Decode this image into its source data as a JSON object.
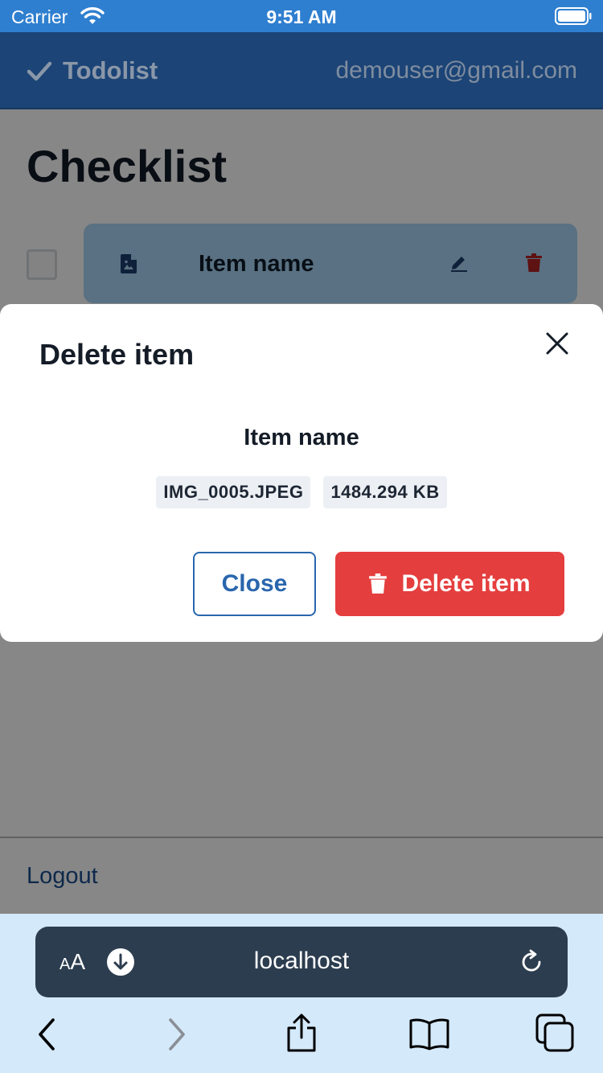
{
  "status_bar": {
    "carrier": "Carrier",
    "time": "9:51 AM"
  },
  "header": {
    "brand": "Todolist",
    "user_email": "demouser@gmail.com"
  },
  "page": {
    "title": "Checklist",
    "item_name": "Item name",
    "logout": "Logout"
  },
  "modal": {
    "title": "Delete item",
    "item_name": "Item name",
    "file_name": "IMG_0005.JPEG",
    "file_size": "1484.294 KB",
    "close_label": "Close",
    "delete_label": "Delete item"
  },
  "browser": {
    "aa_small": "A",
    "aa_large": "A",
    "url": "localhost"
  },
  "colors": {
    "status_bar": "#2f7fd0",
    "header": "#1c4477",
    "danger": "#e53e3e",
    "primary": "#2966ad",
    "item_card": "#a9d5f6"
  }
}
